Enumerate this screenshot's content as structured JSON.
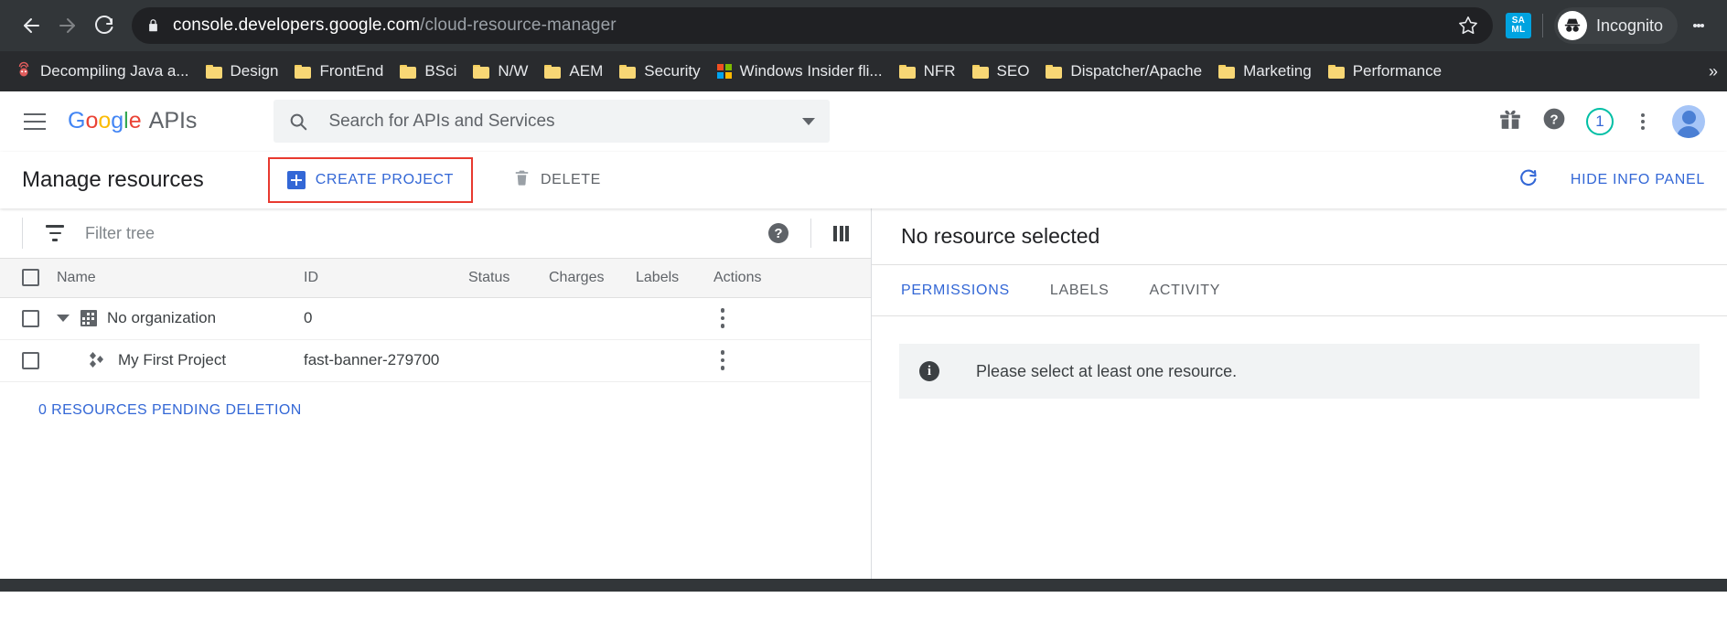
{
  "browser": {
    "back_icon": "arrow-left-icon",
    "forward_icon": "arrow-right-icon",
    "reload_icon": "reload-icon",
    "lock_icon": "lock-icon",
    "url_domain": "console.developers.google.com",
    "url_path": "/cloud-resource-manager",
    "bookmark_star_icon": "star-icon",
    "extension_label_line1": "SA",
    "extension_label_line2": "ML",
    "profile_label": "Incognito",
    "menu_icon": "three-dot-menu-icon",
    "bookmarks": [
      {
        "label": "Decompiling Java a...",
        "icon": "bug-icon"
      },
      {
        "label": "Design",
        "icon": "folder-icon"
      },
      {
        "label": "FrontEnd",
        "icon": "folder-icon"
      },
      {
        "label": "BSci",
        "icon": "folder-icon"
      },
      {
        "label": "N/W",
        "icon": "folder-icon"
      },
      {
        "label": "AEM",
        "icon": "folder-icon"
      },
      {
        "label": "Security",
        "icon": "folder-icon"
      },
      {
        "label": "Windows Insider fli...",
        "icon": "windows-icon"
      },
      {
        "label": "NFR",
        "icon": "folder-icon"
      },
      {
        "label": "SEO",
        "icon": "folder-icon"
      },
      {
        "label": "Dispatcher/Apache",
        "icon": "folder-icon"
      },
      {
        "label": "Marketing",
        "icon": "folder-icon"
      },
      {
        "label": "Performance",
        "icon": "folder-icon"
      }
    ],
    "bookmarks_overflow": "»"
  },
  "header": {
    "menu_icon": "hamburger-menu-icon",
    "brand_google": [
      "G",
      "o",
      "o",
      "g",
      "l",
      "e"
    ],
    "brand_suffix": "APIs",
    "search_placeholder": "Search for APIs and Services",
    "search_value": "",
    "search_icon": "search-icon",
    "dropdown_icon": "chevron-down-icon",
    "gift_icon": "gift-icon",
    "help_icon": "help-circle-icon",
    "notification_count": "1",
    "kebab_icon": "three-dot-menu-icon",
    "avatar_icon": "user-avatar-icon"
  },
  "actionbar": {
    "page_title": "Manage resources",
    "create_project_label": "CREATE PROJECT",
    "create_project_icon": "plus-square-icon",
    "delete_label": "DELETE",
    "delete_icon": "trash-icon",
    "refresh_icon": "refresh-icon",
    "hide_info_panel_label": "HIDE INFO PANEL",
    "highlight_color": "#e8392f"
  },
  "filterbar": {
    "filter_icon": "filter-icon",
    "filter_placeholder": "Filter tree",
    "filter_value": "",
    "help_icon": "help-circle-icon",
    "columns_icon": "columns-icon"
  },
  "table": {
    "columns": [
      "Name",
      "ID",
      "Status",
      "Charges",
      "Labels",
      "Actions"
    ],
    "rows": [
      {
        "name": "No organization",
        "id": "0",
        "status": "",
        "charges": "",
        "labels": "",
        "icon": "organization-icon",
        "expander": "caret-down-icon",
        "indent": 0,
        "checked": false
      },
      {
        "name": "My First Project",
        "id": "fast-banner-279700",
        "status": "",
        "charges": "",
        "labels": "",
        "icon": "project-icon",
        "expander": "",
        "indent": 1,
        "checked": false
      }
    ],
    "pending_deletion_link": "0 RESOURCES PENDING DELETION"
  },
  "info_panel": {
    "title": "No resource selected",
    "tabs": [
      {
        "label": "PERMISSIONS",
        "active": true
      },
      {
        "label": "LABELS",
        "active": false
      },
      {
        "label": "ACTIVITY",
        "active": false
      }
    ],
    "notice_icon": "info-icon",
    "notice_text": "Please select at least one resource."
  },
  "colors": {
    "accent_blue": "#3367d6",
    "highlight_red": "#e8392f",
    "chrome_dark": "#323639",
    "badge_teal": "#00bfa5"
  }
}
